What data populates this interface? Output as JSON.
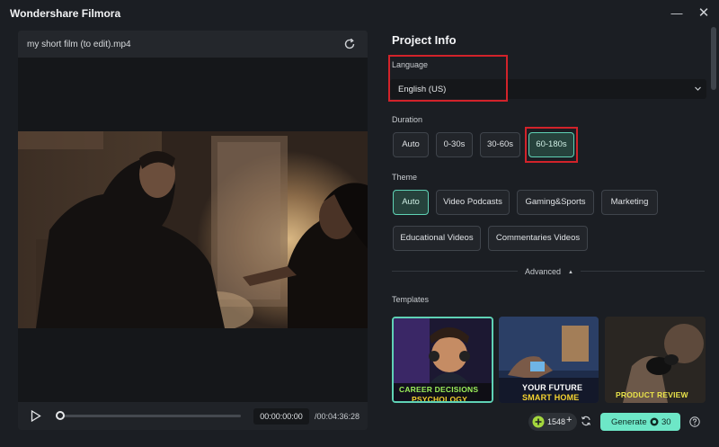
{
  "window": {
    "title": "Wondershare Filmora",
    "minimize_glyph": "—",
    "close_glyph": "✕"
  },
  "preview": {
    "file_name": "my short film (to edit).mp4",
    "current_time": "00:00:00:00",
    "total_time": "/00:04:36:28",
    "progress": 0
  },
  "project_info": {
    "title": "Project Info",
    "language_label": "Language",
    "language_value": "English (US)",
    "duration_label": "Duration",
    "durations": [
      "Auto",
      "0-30s",
      "30-60s",
      "60-180s"
    ],
    "duration_selected": "60-180s",
    "theme_label": "Theme",
    "themes": [
      "Auto",
      "Video Podcasts",
      "Gaming&Sports",
      "Marketing",
      "Educational Videos",
      "Commentaries Videos"
    ],
    "theme_selected": "Auto",
    "advanced_label": "Advanced",
    "templates_label": "Templates",
    "templates": [
      {
        "line1": "CAREER DECISIONS",
        "line2": "PSYCHOLOGY"
      },
      {
        "line1": "YOUR FUTURE",
        "line2": "SMART HOME"
      },
      {
        "line1": "PRODUCT REVIEW",
        "line2": ""
      }
    ]
  },
  "footer": {
    "credits": "1548",
    "credits_plus": "+",
    "generate_label": "Generate",
    "generate_cost": "30"
  },
  "colors": {
    "accent": "#6de7c7",
    "highlight": "#d2232a",
    "background": "#1b1e23"
  },
  "icons": [
    "refresh-icon",
    "play-icon",
    "chevron-down-icon",
    "sync-icon",
    "help-icon",
    "coin-icon",
    "plus-icon"
  ]
}
